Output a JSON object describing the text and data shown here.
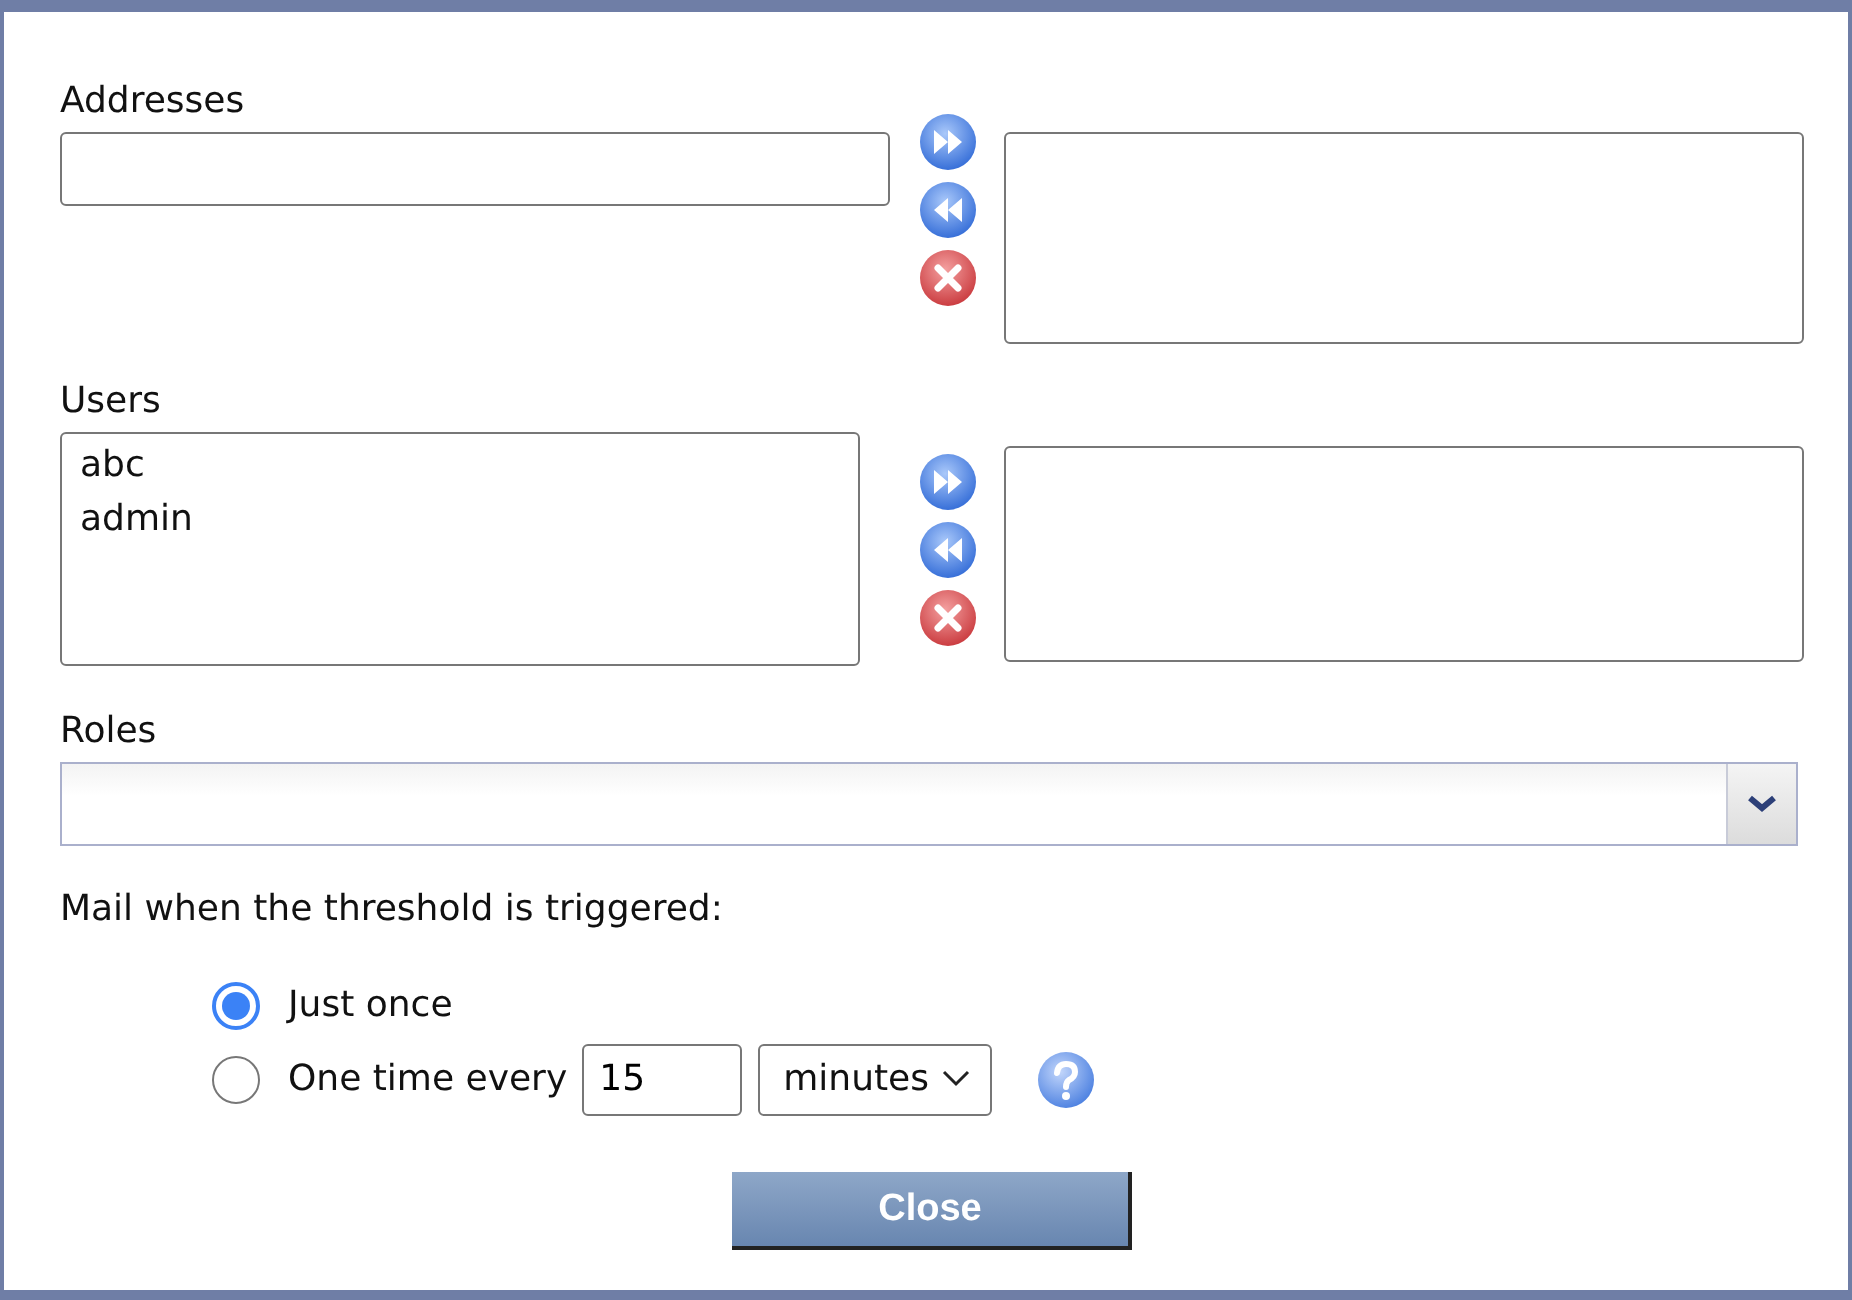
{
  "addresses": {
    "label": "Addresses"
  },
  "users": {
    "label": "Users",
    "items": [
      {
        "text": "abc",
        "selected": false
      },
      {
        "text": "admin",
        "selected": false
      }
    ]
  },
  "roles": {
    "label": "Roles"
  },
  "mail": {
    "label": "Mail when the threshold is triggered:",
    "options": [
      {
        "kind": "plain",
        "label": "Just once",
        "selected": true
      },
      {
        "kind": "interval",
        "label": "One time every",
        "value": "15",
        "unit": "minutes",
        "selected": false
      }
    ]
  },
  "close_button": "Close"
}
